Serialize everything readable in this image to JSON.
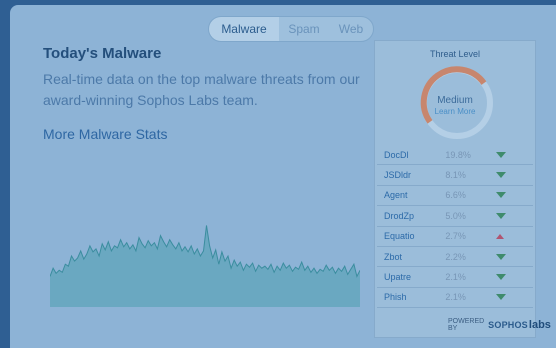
{
  "tabs": [
    "Malware",
    "Spam",
    "Web"
  ],
  "main": {
    "title": "Today's Malware",
    "description": "Real-time data on the top malware threats from our award-winning Sophos Labs team.",
    "more_link": "More Malware Stats"
  },
  "threat_panel": {
    "heading": "Threat Level",
    "level": "Medium",
    "learn_more": "Learn More",
    "threats": [
      {
        "name": "DocDl",
        "percent": "19.8%",
        "trend": "down"
      },
      {
        "name": "JSDldr",
        "percent": "8.1%",
        "trend": "down"
      },
      {
        "name": "Agent",
        "percent": "6.6%",
        "trend": "down"
      },
      {
        "name": "DrodZp",
        "percent": "5.0%",
        "trend": "down"
      },
      {
        "name": "Equatio",
        "percent": "2.7%",
        "trend": "up"
      },
      {
        "name": "Zbot",
        "percent": "2.2%",
        "trend": "down"
      },
      {
        "name": "Upatre",
        "percent": "2.1%",
        "trend": "down"
      },
      {
        "name": "Phish",
        "percent": "2.1%",
        "trend": "down"
      }
    ]
  },
  "footer": {
    "powered_by": "POWERED BY",
    "brand": "SOPHOS",
    "labs": "labs"
  },
  "colors": {
    "accent": "#2e67a3",
    "chart_fill": "#4f9fb0",
    "gauge_arc": "#c7866e",
    "trend_down": "#3f8b6c",
    "trend_up": "#b05571"
  },
  "chart_data": {
    "type": "area",
    "ylim": [
      0,
      100
    ],
    "values": [
      30,
      38,
      33,
      36,
      34,
      42,
      40,
      50,
      45,
      48,
      55,
      47,
      52,
      60,
      54,
      57,
      50,
      62,
      56,
      64,
      55,
      60,
      58,
      66,
      59,
      63,
      57,
      61,
      55,
      68,
      62,
      58,
      65,
      60,
      63,
      57,
      70,
      64,
      59,
      66,
      61,
      57,
      63,
      55,
      59,
      54,
      60,
      52,
      57,
      50,
      55,
      80,
      60,
      48,
      56,
      42,
      54,
      45,
      50,
      38,
      46,
      40,
      44,
      36,
      42,
      39,
      43,
      35,
      41,
      38,
      40,
      37,
      42,
      34,
      40,
      36,
      43,
      38,
      41,
      35,
      39,
      37,
      44,
      36,
      40,
      34,
      38,
      33,
      37,
      35,
      41,
      36,
      39,
      33,
      38,
      35,
      40,
      32,
      37,
      42,
      30,
      36
    ]
  }
}
